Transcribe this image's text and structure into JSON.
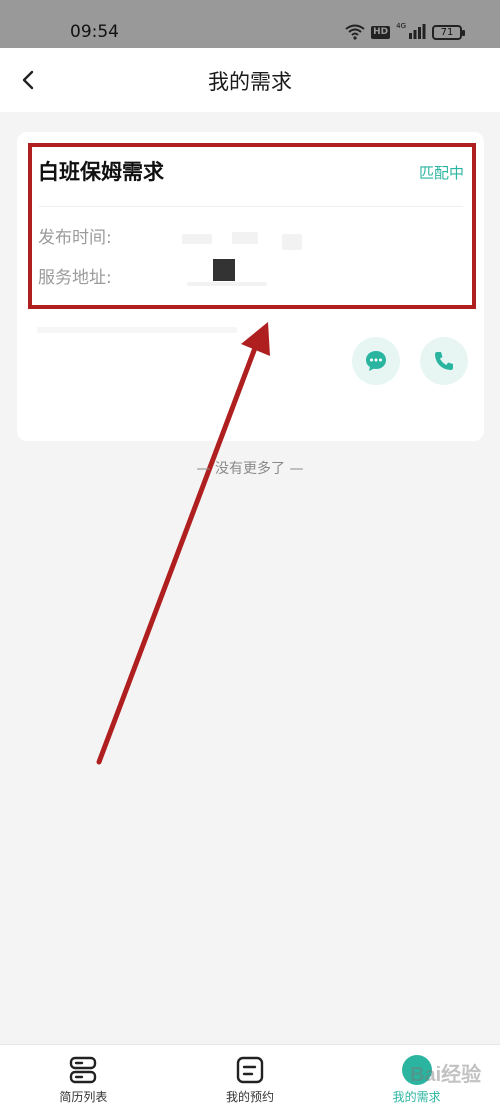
{
  "status_bar": {
    "time": "09:54",
    "hd_badge": "HD",
    "signal_label": "4G",
    "battery_level": "71",
    "icons": [
      "wifi-icon",
      "hd-icon",
      "signal-icon",
      "battery-icon"
    ]
  },
  "header": {
    "title": "我的需求",
    "back_icon": "chevron-left-icon"
  },
  "card": {
    "title": "白班保姆需求",
    "status": "匹配中",
    "fields": {
      "publish_time_label": "发布时间:",
      "service_address_label": "服务地址:"
    },
    "actions": {
      "message_icon": "chat-bubble-icon",
      "call_icon": "phone-icon"
    }
  },
  "list_footer": "— 没有更多了 —",
  "bottom_nav": {
    "items": [
      {
        "label": "简历列表",
        "icon": "resume-list-icon"
      },
      {
        "label": "我的预约",
        "icon": "appointment-icon"
      },
      {
        "label": "我的需求",
        "icon": "my-demand-icon",
        "active": true
      }
    ]
  },
  "watermark": "Bai经验",
  "colors": {
    "accent": "#2bb5a0",
    "annotation": "#b01f1f",
    "status_bar": "#999999",
    "page_background": "#f4f4f4"
  }
}
